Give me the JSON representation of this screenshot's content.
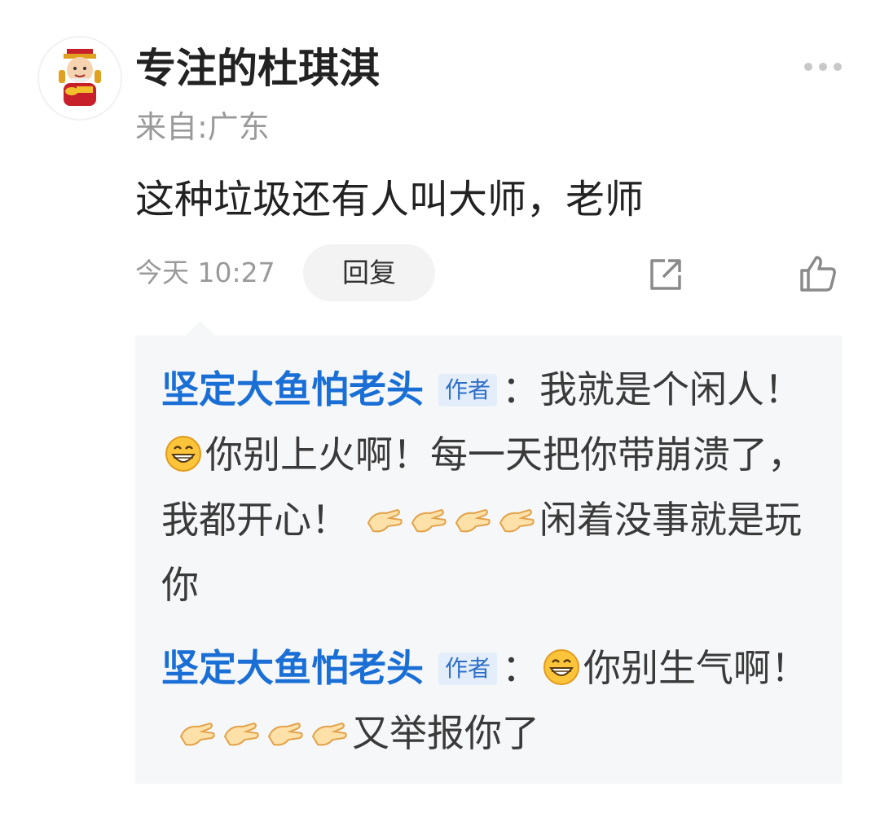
{
  "post": {
    "username": "专注的杜琪淇",
    "location": "来自:广东",
    "text": "这种垃圾还有人叫大师，老师",
    "timestamp": "今天 10:27",
    "reply_label": "回复"
  },
  "icons": {
    "more": "more-dots-icon",
    "share": "share-icon",
    "like": "thumbs-up-icon",
    "grin": "grinning-emoji-icon",
    "clap": "clapping-hands-icon"
  },
  "colors": {
    "author_link": "#1a6fd6",
    "badge_bg": "#e4eefb",
    "panel_bg": "#f6f7f8",
    "muted": "#9a9a9a"
  },
  "replies": [
    {
      "author": "坚定大鱼怕老头",
      "badge": "作者",
      "prefix": "：我就是个闲人！",
      "text_after_emoji": "你别上火啊！每一天把你带崩溃了，我都开心！",
      "clap_count": 4,
      "tail": "闲着没事就是玩你"
    },
    {
      "author": "坚定大鱼怕老头",
      "badge": "作者",
      "prefix": "：",
      "text_after_emoji": "你别生气啊！",
      "clap_count": 4,
      "tail": "又举报你了"
    }
  ]
}
